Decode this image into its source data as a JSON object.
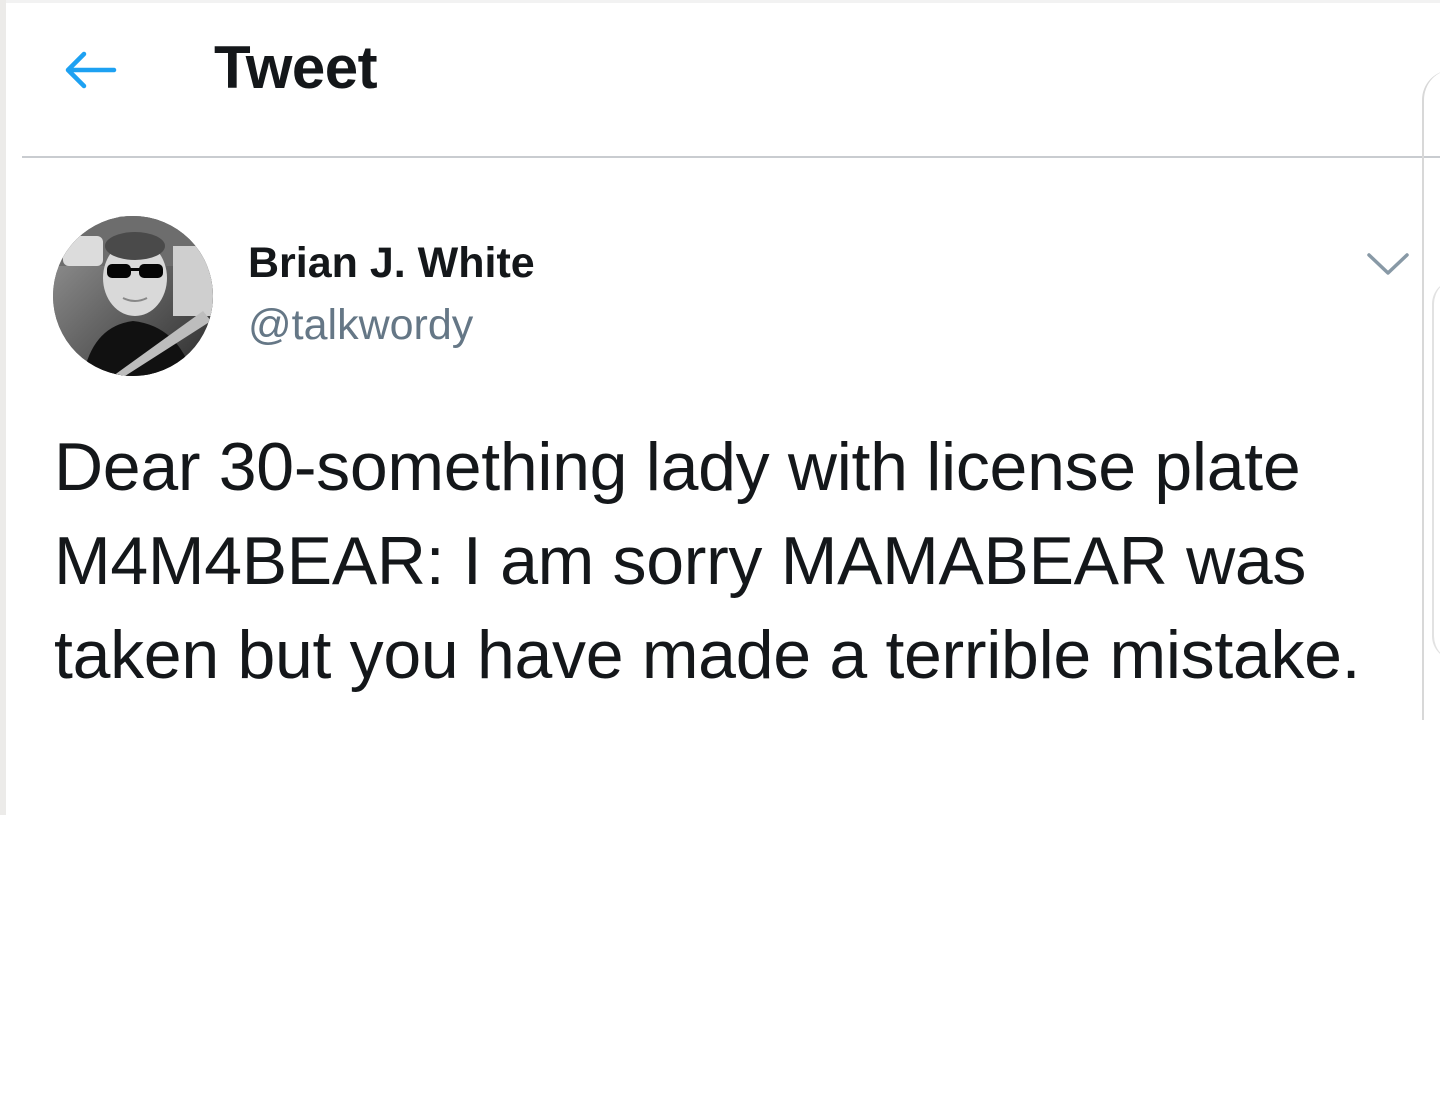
{
  "header": {
    "title": "Tweet",
    "back_icon": "arrow-left-icon",
    "accent_color": "#1da1f2"
  },
  "tweet": {
    "author": {
      "display_name": "Brian J. White",
      "handle": "@talkwordy"
    },
    "text": "Dear 30-something lady with license plate M4M4BEAR: I am sorry MAMABEAR was taken but you have made a terrible mistake.",
    "more_icon": "chevron-down-icon"
  },
  "colors": {
    "text_primary": "#14171a",
    "text_secondary": "#657786",
    "divider": "#c9ccd0"
  }
}
